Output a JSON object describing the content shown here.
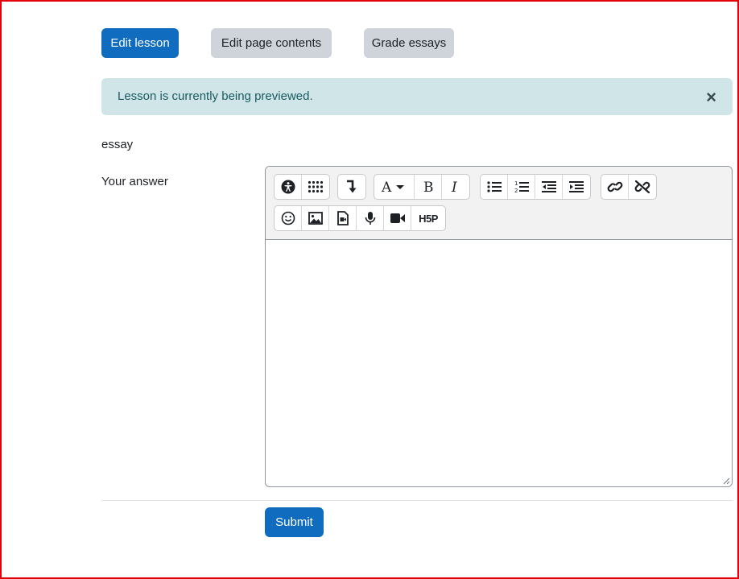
{
  "header_buttons": {
    "edit_lesson": "Edit lesson",
    "edit_page_contents": "Edit page contents",
    "grade_essays": "Grade essays"
  },
  "alert": {
    "message": "Lesson is currently being previewed.",
    "close_glyph": "×"
  },
  "question": {
    "title": "essay",
    "answer_label": "Your answer",
    "answer_value": ""
  },
  "toolbar": {
    "row1": [
      "accessibility-checker-icon",
      "more-buttons-grid-icon",
      "insert-arrow-icon",
      "font-color-icon",
      "bold-icon",
      "italic-icon",
      "unordered-list-icon",
      "ordered-list-icon",
      "outdent-icon",
      "indent-icon",
      "link-icon",
      "unlink-icon"
    ],
    "row2": [
      "emoji-icon",
      "image-icon",
      "media-file-icon",
      "record-audio-icon",
      "record-video-icon",
      "h5p-icon"
    ],
    "h5p_label": "H5P"
  },
  "submit": {
    "label": "Submit"
  },
  "colors": {
    "primary": "#0f6cbf",
    "secondary": "#ced4da",
    "alert_bg": "#cfe5e8",
    "alert_text": "#1b5a63",
    "frame": "#e3000b"
  }
}
